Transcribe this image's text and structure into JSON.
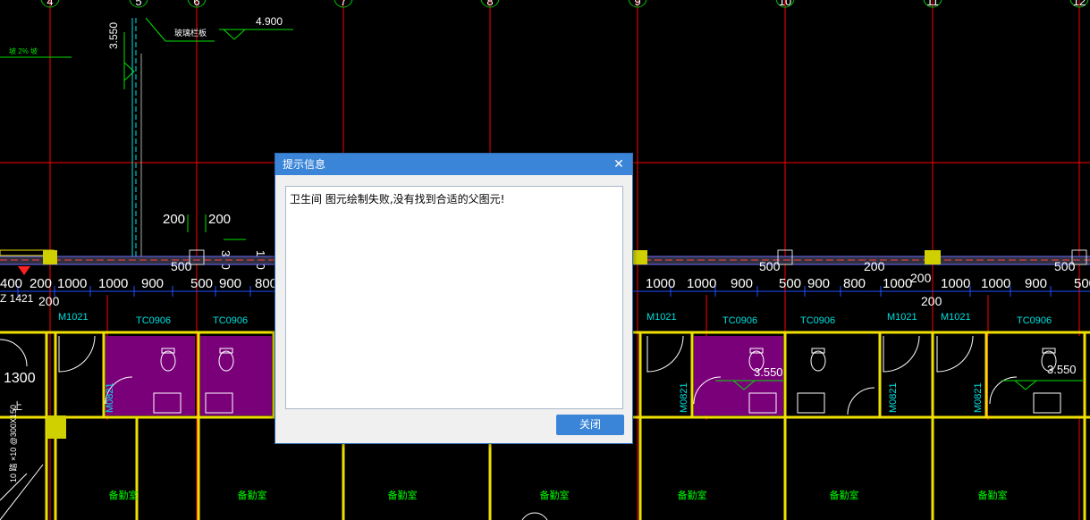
{
  "colors": {
    "background": "#000000",
    "axis_line": "#ff0000",
    "dimension_line": "#1f4fff",
    "wall": "#f0e000",
    "room_fill": "#7a007a",
    "label_cyan": "#00e0e0",
    "label_green": "#00ff00",
    "dialog_title_bg": "#3a85d8",
    "dialog_button_bg": "#3a85d8"
  },
  "cad": {
    "axis_numbers": [
      "4",
      "5",
      "6",
      "7",
      "8",
      "9",
      "10",
      "11",
      "12"
    ],
    "elevations": {
      "left": "3.550",
      "top": "4.900",
      "room_a": "3.550",
      "room_b": "3.550"
    },
    "labels": {
      "railing": "玻璃栏板",
      "slope": "坡 2% 坡",
      "dim_200_a": "200",
      "dim_200_b": "200",
      "dim_300": "300",
      "dim_100": "100",
      "dim_500_a": "500",
      "dim_500_b": "500",
      "dim_500_c": "500",
      "dim_200_c": "200",
      "dim_200_d": "200",
      "dim_200_e": "200",
      "dim_200_left": "200",
      "dim_1300": "1300",
      "mark_1421": "Z 1421",
      "stair_up": "上",
      "stair_note": "10 踏 ×10 @300X150"
    },
    "dim_row_left": [
      "400",
      "200",
      "1000",
      "1000",
      "900",
      "500",
      "900",
      "800"
    ],
    "dim_row_right": [
      "1000",
      "1000",
      "900",
      "500",
      "900",
      "800",
      "1000",
      "1000",
      "1000",
      "900",
      "500"
    ],
    "door_window": {
      "m1021_a": "M1021",
      "tc0906_a": "TC0906",
      "tc0906_b": "TC0906",
      "m1021_b": "M1021",
      "tc0906_c": "TC0906",
      "tc0906_d": "TC0906",
      "m1021_c": "M1021",
      "m1021_d": "M1021",
      "tc0906_e": "TC0906",
      "m0821_a": "M0821",
      "m0821_b": "M0821",
      "m0821_c": "M0821",
      "m0821_d": "M0821"
    },
    "rooms": [
      "备勤室",
      "备勤室",
      "备勤室",
      "备勤室",
      "备勤室",
      "备勤室",
      "备勤室"
    ]
  },
  "dialog": {
    "title": "提示信息",
    "close_icon": "close-icon",
    "message": "卫生间 图元绘制失败,没有找到合适的父图元!",
    "button_label": "关闭"
  }
}
